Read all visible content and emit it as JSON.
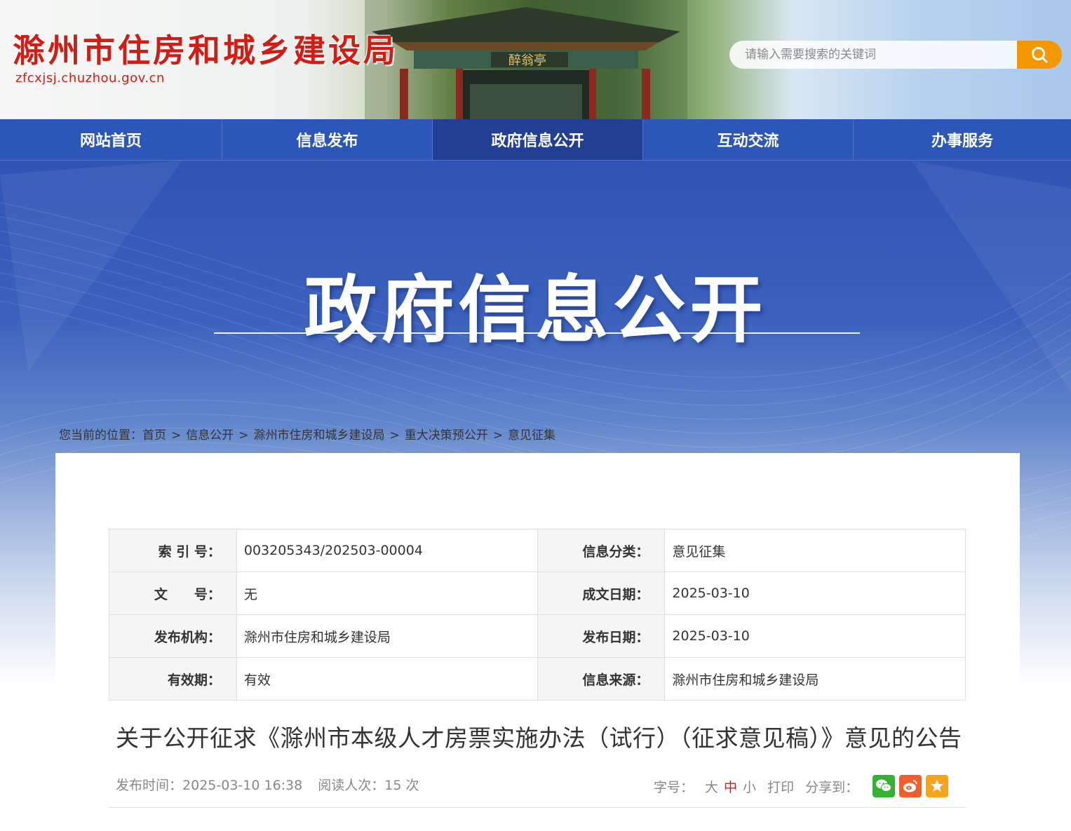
{
  "header": {
    "site_title": "滁州市住房和城乡建设局",
    "site_domain": "zfcxjsj.chuzhou.gov.cn",
    "search_placeholder": "请输入需要搜索的关键词",
    "pavilion_sign": "醉翁亭"
  },
  "nav": {
    "items": [
      {
        "label": "网站首页"
      },
      {
        "label": "信息发布"
      },
      {
        "label": "政府信息公开",
        "active": true
      },
      {
        "label": "互动交流"
      },
      {
        "label": "办事服务"
      }
    ]
  },
  "banner": {
    "title": "政府信息公开"
  },
  "breadcrumb": {
    "prefix": "您当前的位置：",
    "items": [
      "首页",
      "信息公开",
      "滁州市住房和城乡建设局",
      "重大决策预公开",
      "意见征集"
    ],
    "separator": ">"
  },
  "meta": {
    "rows": [
      {
        "l1": "索 引 号：",
        "v1": "003205343/202503-00004",
        "l2": "信息分类：",
        "v2": "意见征集"
      },
      {
        "l1": "文　　号：",
        "v1": "无",
        "l2": "成文日期：",
        "v2": "2025-03-10"
      },
      {
        "l1": "发布机构：",
        "v1": "滁州市住房和城乡建设局",
        "l2": "发布日期：",
        "v2": "2025-03-10"
      },
      {
        "l1": "有效期：",
        "v1": "有效",
        "l2": "信息来源：",
        "v2": "滁州市住房和城乡建设局"
      }
    ]
  },
  "article": {
    "title": "关于公开征求《滁州市本级人才房票实施办法（试行）（征求意见稿）》意见的公告",
    "publish_label": "发布时间：",
    "publish_time": "2025-03-10 16:38",
    "views_label": "阅读人次：",
    "views": "15 次"
  },
  "tools": {
    "font_label": "字号：",
    "font_big": "大",
    "font_mid": "中",
    "font_small": "小",
    "print": "打印",
    "share_label": "分享到："
  },
  "colors": {
    "brand_red": "#d21c14",
    "nav_blue": "#2c56b7",
    "nav_active": "#233f93",
    "search_orange": "#f39800"
  }
}
